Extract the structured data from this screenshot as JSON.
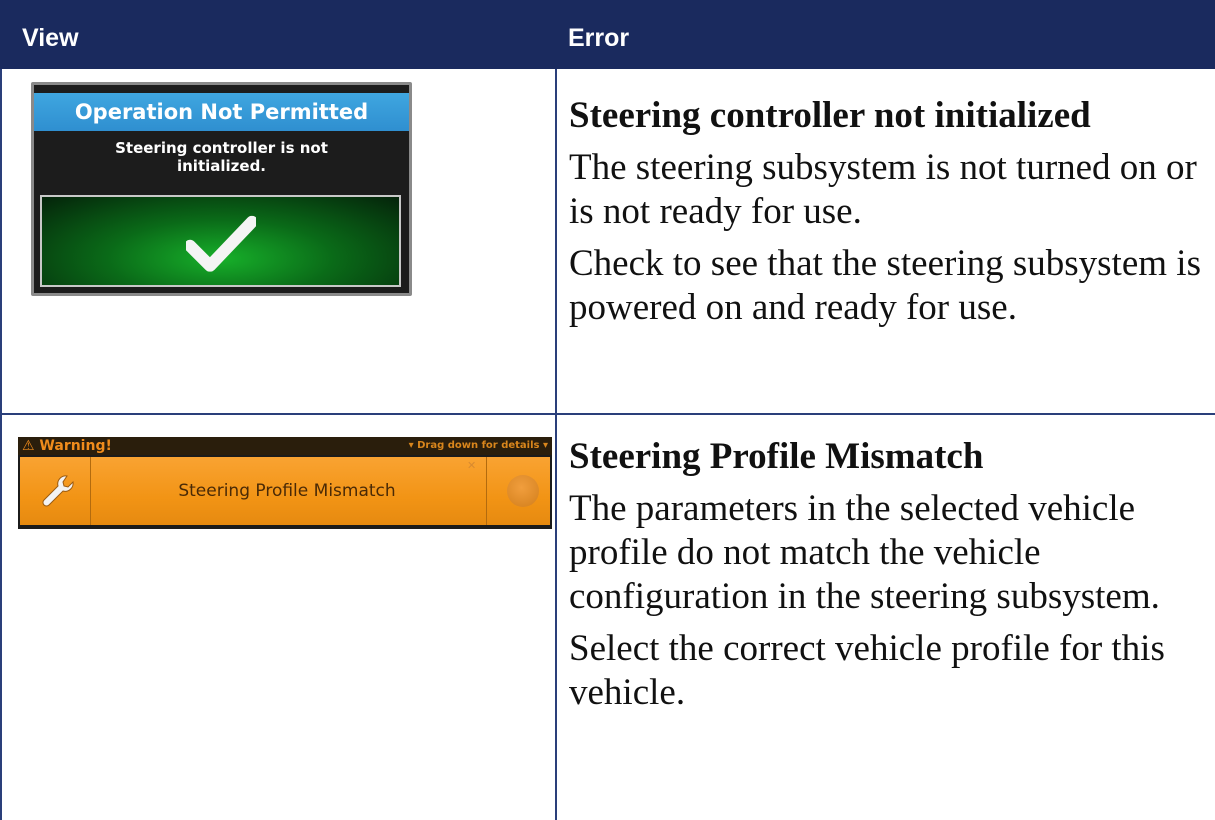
{
  "header": {
    "view_label": "View",
    "error_label": "Error"
  },
  "rows": [
    {
      "view": {
        "dialog_title": "Operation Not Permitted",
        "dialog_message_line1": "Steering controller is not",
        "dialog_message_line2": "initialized.",
        "ok_icon": "checkmark-icon"
      },
      "error": {
        "title": "Steering controller not initialized",
        "description": "The steering subsystem is not turned on or is not ready for use.",
        "action": "Check to see that the steering subsystem is powered on and ready for use."
      }
    },
    {
      "view": {
        "warning_title": "⚠ Warning!",
        "drag_hint": "▾ Drag down for details ▾",
        "message": "Steering Profile Mismatch",
        "left_icon": "wrench-icon",
        "right_icon": "circle-icon"
      },
      "error": {
        "title": "Steering Profile Mismatch",
        "description": "The parameters in the selected vehicle profile do not match the vehicle configuration in the steering subsystem.",
        "action": "Select the correct vehicle profile for this vehicle."
      }
    }
  ],
  "colors": {
    "header_bg": "#1a2a5e",
    "rule": "#2a3f7a",
    "dialog_title_bg": "#2f8fd0",
    "ok_green": "#17b02a",
    "warning_orange": "#f29415"
  }
}
